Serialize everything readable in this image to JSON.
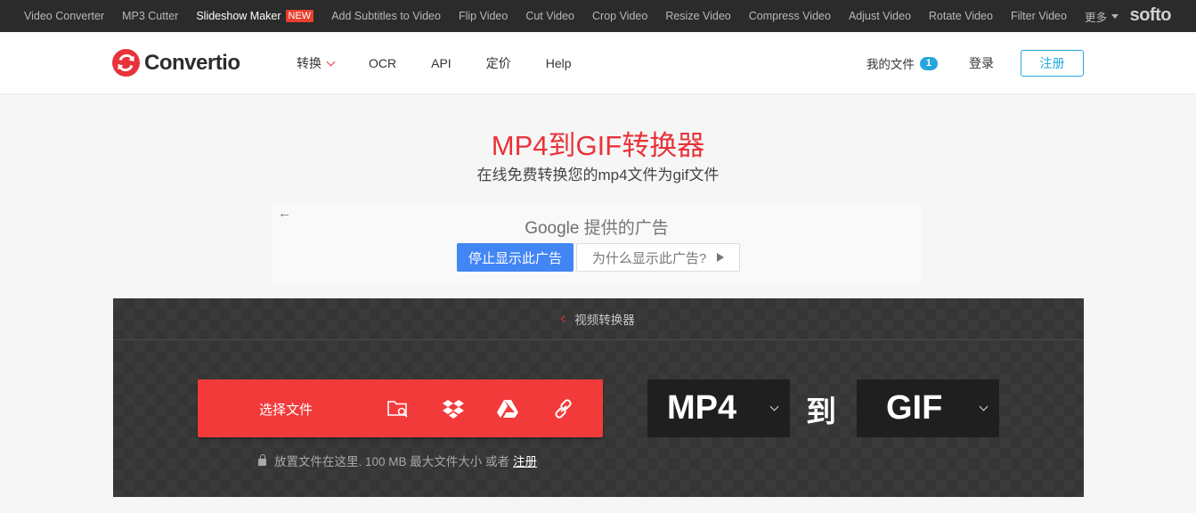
{
  "topbar": {
    "tools": [
      {
        "label": "Video Converter"
      },
      {
        "label": "MP3 Cutter"
      },
      {
        "label": "Slideshow Maker",
        "badge": "NEW",
        "active": true
      },
      {
        "label": "Add Subtitles to Video"
      },
      {
        "label": "Flip Video"
      },
      {
        "label": "Cut Video"
      },
      {
        "label": "Crop Video"
      },
      {
        "label": "Resize Video"
      },
      {
        "label": "Compress Video"
      },
      {
        "label": "Adjust Video"
      },
      {
        "label": "Rotate Video"
      },
      {
        "label": "Filter Video"
      }
    ],
    "more_label": "更多",
    "brand": "softo"
  },
  "nav": {
    "logo_text": "Convertio",
    "links": [
      "转换",
      "OCR",
      "API",
      "定价",
      "Help"
    ],
    "files_label": "我的文件",
    "files_count": "1",
    "login_label": "登录",
    "signup_label": "注册"
  },
  "hero": {
    "title": "MP4到GIF转换器",
    "subtitle": "在线免费转换您的mp4文件为gif文件"
  },
  "ad": {
    "google": "Google",
    "provided": "提供的广告",
    "stop_label": "停止显示此广告",
    "why_label": "为什么显示此广告?"
  },
  "converter": {
    "breadcrumb": "视频转换器",
    "choose_label": "选择文件",
    "drop_text": "放置文件在这里. 100 MB 最大文件大小 或者",
    "drop_link": "注册",
    "from_format": "MP4",
    "to_word": "到",
    "to_format": "GIF"
  },
  "colors": {
    "accent": "#e8333a",
    "link_blue": "#26a6e0",
    "google_blue": "#4285f4"
  }
}
